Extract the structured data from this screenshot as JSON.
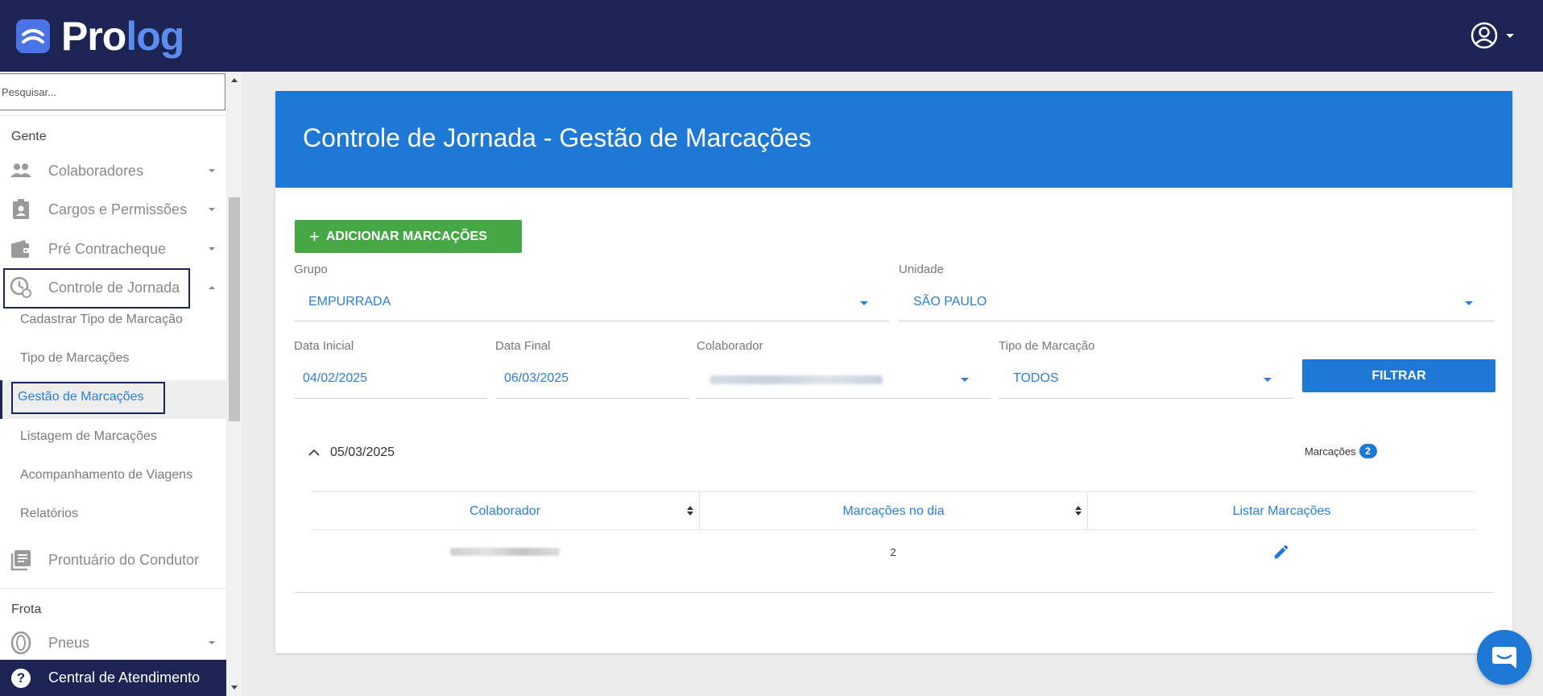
{
  "brand": {
    "name_part1": "Pro",
    "name_part2": "log"
  },
  "search": {
    "placeholder": "Pesquisar..."
  },
  "sidebar": {
    "section_gente": "Gente",
    "section_frota": "Frota",
    "items": {
      "colaboradores": "Colaboradores",
      "cargos": "Cargos e Permissões",
      "pre_contracheque": "Pré Contracheque",
      "controle_jornada": "Controle de Jornada",
      "prontuario": "Prontuário do Condutor",
      "pneus": "Pneus"
    },
    "subitems": {
      "cadastrar_tipo": "Cadastrar Tipo de Marcação",
      "tipo_marcacoes": "Tipo de Marcações",
      "gestao_marcacoes": "Gestão de Marcações",
      "listagem_marcacoes": "Listagem de Marcações",
      "acompanhamento_viagens": "Acompanhamento de Viagens",
      "relatorios": "Relatórios"
    },
    "help": "Central de Atendimento"
  },
  "page": {
    "title": "Controle de Jornada - Gestão de Marcações",
    "add_button": "ADICIONAR MARCAÇÕES",
    "filter_button": "FILTRAR"
  },
  "filters": {
    "grupo": {
      "label": "Grupo",
      "value": "EMPURRADA"
    },
    "unidade": {
      "label": "Unidade",
      "value": "SÃO PAULO"
    },
    "data_inicial": {
      "label": "Data Inicial",
      "value": "04/02/2025"
    },
    "data_final": {
      "label": "Data Final",
      "value": "06/03/2025"
    },
    "colaborador": {
      "label": "Colaborador"
    },
    "tipo_marcacao": {
      "label": "Tipo de Marcação",
      "value": "TODOS"
    }
  },
  "group": {
    "date": "05/03/2025",
    "count_label": "Marcações",
    "count": "2"
  },
  "table": {
    "headers": [
      "Colaborador",
      "Marcações no dia",
      "Listar Marcações"
    ],
    "rows": [
      {
        "marcacoes_no_dia": "2"
      }
    ]
  },
  "colors": {
    "navy": "#1c2454",
    "primary_blue": "#1e78d6",
    "green": "#45a844",
    "link_blue": "#2a7fd4"
  },
  "icons": {
    "users": "people-icon",
    "badge": "id-badge-icon",
    "wallet": "wallet-icon",
    "clock": "clock-icon",
    "book": "book-icon",
    "tire": "tire-icon",
    "help": "question-icon",
    "user": "account-circle-icon",
    "edit": "pencil-icon",
    "chat": "chat-icon"
  }
}
